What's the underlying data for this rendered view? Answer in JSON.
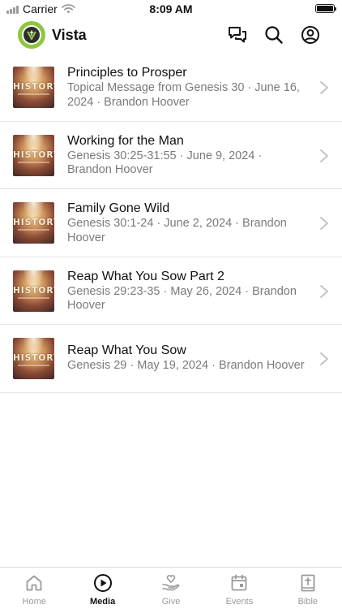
{
  "status_bar": {
    "carrier": "Carrier",
    "time": "8:09 AM"
  },
  "header": {
    "title": "Vista",
    "logo_icon": "vista-church-logo",
    "actions": [
      "chat-icon",
      "search-icon",
      "profile-icon"
    ]
  },
  "media_list": [
    {
      "title": "Principles to Prosper",
      "subtitle": "Topical Message from Genesis 30 · June 16, 2024 · Brandon Hoover",
      "thumbnail_text": "HISTORY"
    },
    {
      "title": "Working for the Man",
      "subtitle": "Genesis 30:25-31:55 · June 9, 2024 · Brandon Hoover",
      "thumbnail_text": "HISTORY"
    },
    {
      "title": "Family Gone Wild",
      "subtitle": "Genesis 30:1-24 · June 2, 2024 · Brandon Hoover",
      "thumbnail_text": "HISTORY"
    },
    {
      "title": "Reap What You Sow Part 2",
      "subtitle": "Genesis 29:23-35 · May 26, 2024 · Brandon Hoover",
      "thumbnail_text": "HISTORY"
    },
    {
      "title": "Reap What You Sow",
      "subtitle": "Genesis 29 · May 19, 2024 · Brandon Hoover",
      "thumbnail_text": "HISTORY"
    }
  ],
  "tab_bar": {
    "active": "Media",
    "tabs": [
      {
        "label": "Home",
        "icon": "home-icon"
      },
      {
        "label": "Media",
        "icon": "play-circle-icon"
      },
      {
        "label": "Give",
        "icon": "give-heart-icon"
      },
      {
        "label": "Events",
        "icon": "calendar-icon"
      },
      {
        "label": "Bible",
        "icon": "bible-icon"
      }
    ]
  },
  "colors": {
    "brand_green": "#8dc63f",
    "text_primary": "#111111",
    "text_secondary": "#7a7a7a",
    "tab_inactive": "#9a9a9a"
  }
}
